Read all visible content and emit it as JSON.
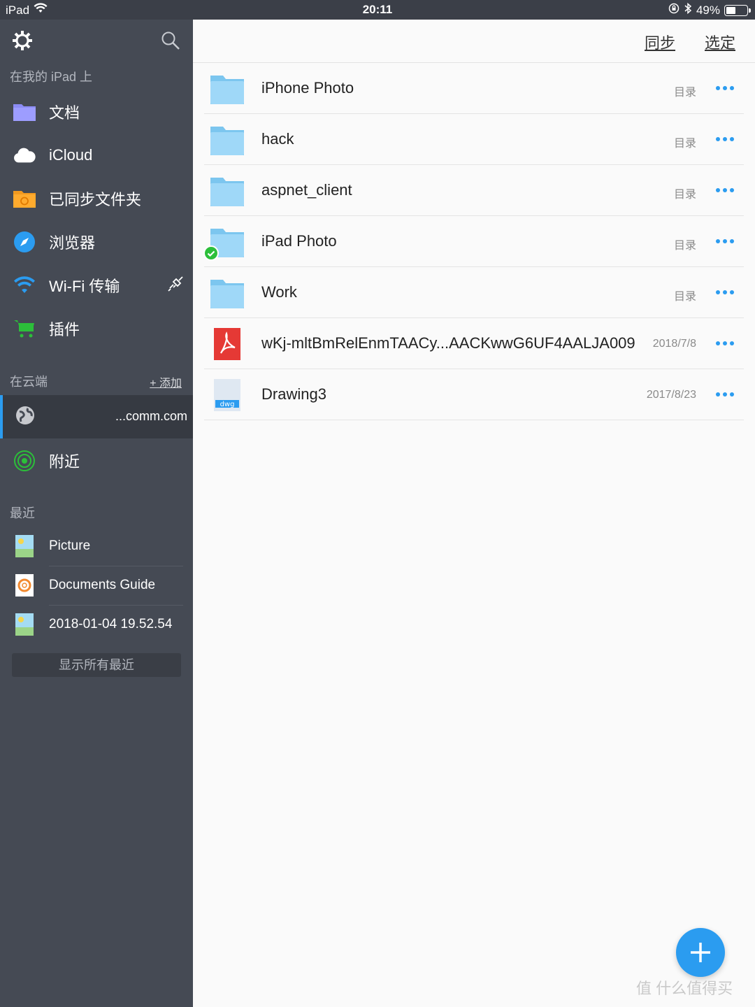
{
  "status_bar": {
    "device": "iPad",
    "time": "20:11",
    "battery_text": "49%",
    "battery_level": 0.49
  },
  "sidebar": {
    "local_header": "在我的 iPad 上",
    "items": [
      {
        "label": "文档",
        "icon": "folder-icon"
      },
      {
        "label": "iCloud",
        "icon": "cloud-icon"
      },
      {
        "label": "已同步文件夹",
        "icon": "sync-folder-icon"
      },
      {
        "label": "浏览器",
        "icon": "compass-icon"
      },
      {
        "label": "Wi-Fi 传输",
        "icon": "wifi-icon"
      },
      {
        "label": "插件",
        "icon": "cart-icon"
      }
    ],
    "cloud_header": "在云端",
    "cloud_add": "+ 添加",
    "cloud_account": "...comm.com",
    "nearby": "附近",
    "recent_header": "最近",
    "recent": [
      {
        "label": "Picture",
        "icon": "image-icon"
      },
      {
        "label": "Documents Guide",
        "icon": "lifebuoy-icon"
      },
      {
        "label": "2018-01-04 19.52.54",
        "icon": "image-icon"
      }
    ],
    "show_all_recent": "显示所有最近"
  },
  "toolbar": {
    "sync_label": "同步",
    "select_label": "选定"
  },
  "files": [
    {
      "name": "iPhone Photo",
      "meta": "目录",
      "type": "folder"
    },
    {
      "name": "hack",
      "meta": "目录",
      "type": "folder"
    },
    {
      "name": "aspnet_client",
      "meta": "目录",
      "type": "folder"
    },
    {
      "name": "iPad Photo",
      "meta": "目录",
      "type": "folder",
      "synced": true
    },
    {
      "name": "Work",
      "meta": "目录",
      "type": "folder"
    },
    {
      "name": "wKj-mltBmRelEnmTAACy...AACKwwG6UF4AALJA009",
      "meta": "2018/7/8",
      "type": "pdf"
    },
    {
      "name": "Drawing3",
      "meta": "2017/8/23",
      "type": "dwg",
      "badge": "dwg"
    }
  ],
  "watermark": "值 什么值得买",
  "colors": {
    "accent": "#2b9cf0",
    "sidebar_bg": "#454a54",
    "folder": "#8fd0f5",
    "pdf": "#e53935",
    "check": "#2cbf3a"
  }
}
